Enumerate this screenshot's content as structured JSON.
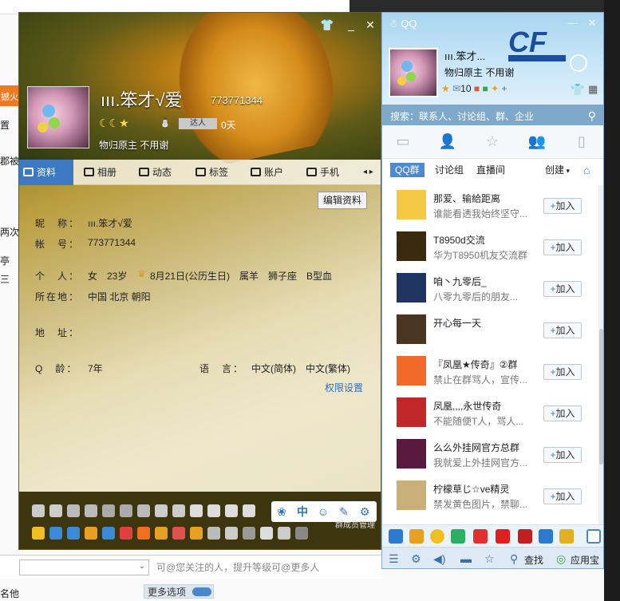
{
  "background": {
    "left_tab_text": "撼火",
    "left_labels": [
      "置",
      "郡被",
      "两次",
      "亭",
      "三"
    ],
    "hint": "可@您关注的人，提升等级可@更多人",
    "more_options": "更多选项",
    "bottom_label": "名他"
  },
  "profile": {
    "nickname": "ııı.笨才√爱",
    "qq_number": "773771344",
    "talent_badge": "达人",
    "days": "0天",
    "signature": "物归原主 不用谢",
    "tabs": [
      "资料",
      "相册",
      "动态",
      "标签",
      "账户",
      "手机"
    ],
    "edit_button": "编辑资料",
    "fields": [
      {
        "label": "昵　称：",
        "value": "ııı.笨才√爱"
      },
      {
        "label": "帐　号：",
        "value": "773771344"
      },
      {
        "label": "个　人：",
        "value": "女　23岁"
      },
      {
        "label": "所在地：",
        "value": "中国 北京 朝阳"
      },
      {
        "label": "地　址：",
        "value": ""
      },
      {
        "label": "Q　龄：",
        "value": "7年"
      }
    ],
    "birthday": "8月21日(公历生日)　属羊　狮子座　B型血",
    "language_label": "语　言：",
    "language_value": "中文(简体)　中文(繁体)　中",
    "permission_link": "权限设置",
    "tools": [
      "paw-icon",
      "中",
      "smile-icon",
      "pen-icon",
      "gear-icon"
    ],
    "group_manager": "群成员管理"
  },
  "qq": {
    "title": "QQ",
    "nickname": "ııı.笨才...",
    "signature": "物归原主 不用谢",
    "mail_count": "10",
    "search_placeholder": "搜索：联系人、讨论组、群、企业",
    "subtabs": [
      "QQ群",
      "讨论组",
      "直播间"
    ],
    "create": "创建",
    "groups": [
      {
        "name": "那爱、输給距离",
        "desc": "谁能看透我始终坚守...",
        "join": "加入",
        "color": "#f4c842"
      },
      {
        "name": "T8950d交流",
        "desc": "华为T8950机友交流群",
        "join": "加入",
        "color": "#3a2a10"
      },
      {
        "name": "咱丶九零后_",
        "desc": "八零九零后的朋友...",
        "join": "加入",
        "color": "#1f3460"
      },
      {
        "name": "开心每一天",
        "desc": "",
        "join": "加入",
        "color": "#4a3422"
      },
      {
        "name": "『凤凰★传奇』②群",
        "desc": "禁止在群骂人，宣传...",
        "join": "加入",
        "color": "#f26a2a"
      },
      {
        "name": "凤凰,,,,永世传奇",
        "desc": "不能随便T人，骂人...",
        "join": "加入",
        "color": "#c0282a"
      },
      {
        "name": "么么外挂网官方总群",
        "desc": "我就爱上外挂网官方...",
        "join": "加入",
        "color": "#5a1a40"
      },
      {
        "name": "柠檬草じ☆ve精灵",
        "desc": "禁发黄色图片，禁聊...",
        "join": "加入",
        "color": "#c8b078"
      }
    ],
    "footer_find": "查找",
    "footer_appstore": "应用宝"
  }
}
